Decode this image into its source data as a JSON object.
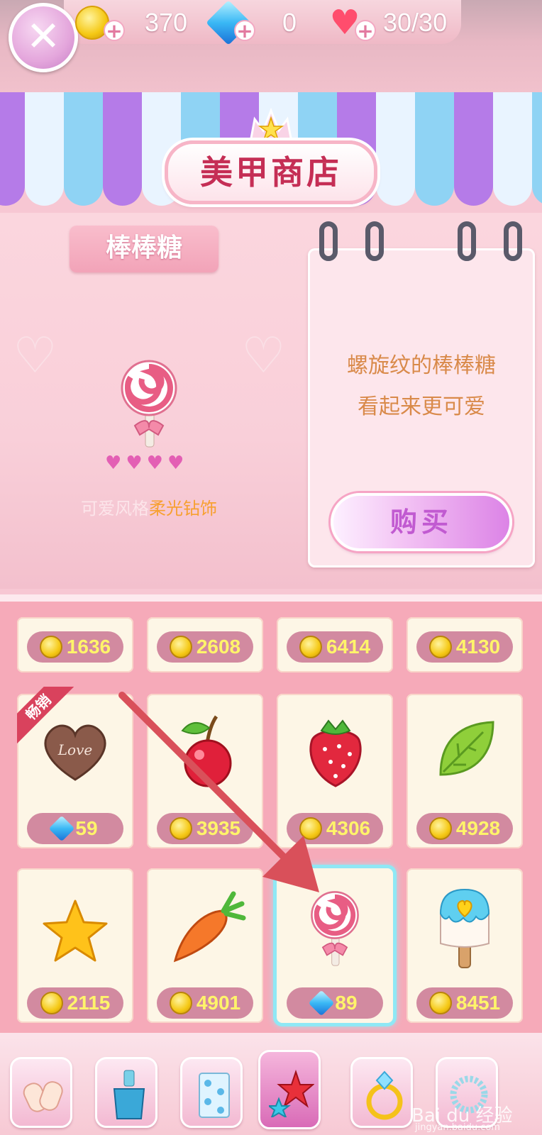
{
  "topbar": {
    "coins": "370",
    "gems": "0",
    "hearts": "30/30"
  },
  "shop": {
    "title": "美甲商店"
  },
  "product": {
    "name": "棒棒糖",
    "tag_style": "可爱风格",
    "tag_effect": "柔光钻饰",
    "desc_line1": "螺旋纹的棒棒糖",
    "desc_line2": "看起来更可爱",
    "buy_label": "购买",
    "rating_hearts": 4
  },
  "top_row_prices": [
    "1636",
    "2608",
    "6414",
    "4130"
  ],
  "items": [
    {
      "name": "love-chocolate",
      "currency": "gem",
      "price": "59",
      "badge": "畅销"
    },
    {
      "name": "cherry",
      "currency": "coin",
      "price": "3935"
    },
    {
      "name": "strawberry",
      "currency": "coin",
      "price": "4306"
    },
    {
      "name": "leaf",
      "currency": "coin",
      "price": "4928"
    },
    {
      "name": "star",
      "currency": "coin",
      "price": "2115"
    },
    {
      "name": "carrot",
      "currency": "coin",
      "price": "4901"
    },
    {
      "name": "lollipop",
      "currency": "gem",
      "price": "89",
      "selected": true
    },
    {
      "name": "popsicle",
      "currency": "coin",
      "price": "8451"
    }
  ],
  "watermark": {
    "main": "Bai du 经验",
    "sub": "jingyan.baidu.com"
  },
  "colors": {
    "accent_pink": "#f6aab9",
    "title_red": "#c52e55",
    "price_yellow": "#fff46a",
    "selected_glow": "#8fe8f5",
    "arrow_red": "#d9505a"
  }
}
